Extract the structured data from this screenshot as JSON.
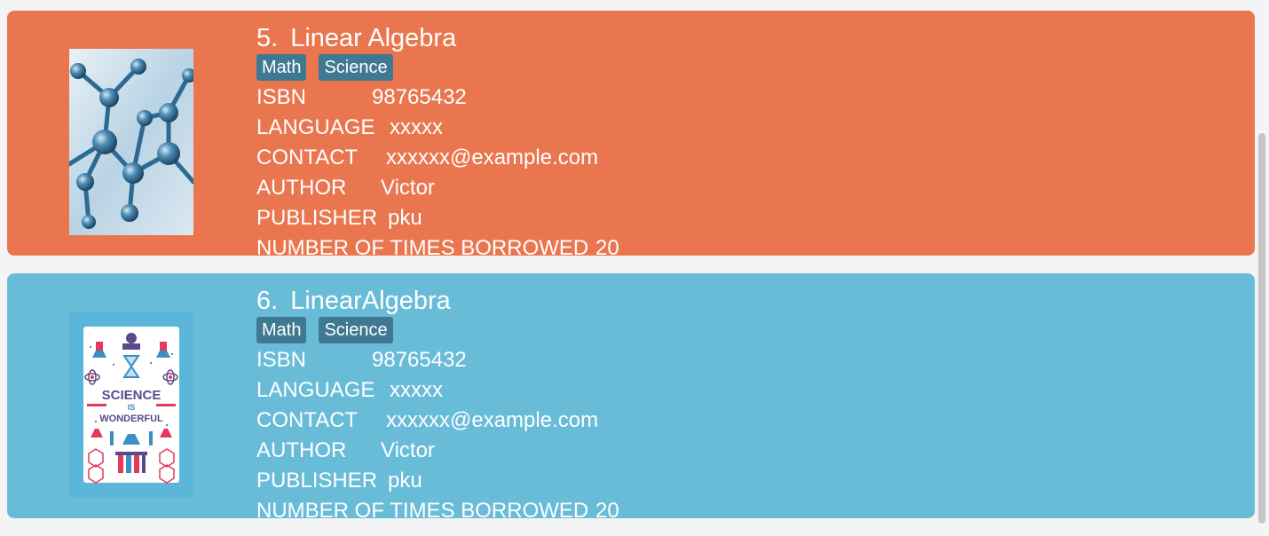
{
  "books": [
    {
      "index": "5.",
      "title": "Linear Algebra",
      "tags": [
        "Math",
        "Science"
      ],
      "labels": {
        "isbn": "ISBN",
        "language": "LANGUAGE",
        "contact": "CONTACT",
        "author": "AUTHOR",
        "publisher": "PUBLISHER",
        "borrowed": "NUMBER OF TIMES BORROWED"
      },
      "isbn": "98765432",
      "language": "xxxxx",
      "contact": "xxxxxx@example.com",
      "author": "Victor",
      "publisher": "pku",
      "borrowed": "20",
      "cover_icon": "molecule-structure-image",
      "color": "#e9764f"
    },
    {
      "index": "6.",
      "title": "LinearAlgebra",
      "tags": [
        "Math",
        "Science"
      ],
      "labels": {
        "isbn": "ISBN",
        "language": "LANGUAGE",
        "contact": "CONTACT",
        "author": "AUTHOR",
        "publisher": "PUBLISHER",
        "borrowed": "NUMBER OF TIMES BORROWED"
      },
      "isbn": "98765432",
      "language": "xxxxx",
      "contact": "xxxxxx@example.com",
      "author": "Victor",
      "publisher": "pku",
      "borrowed": "20",
      "cover_icon": "science-poster-image",
      "cover_text": [
        "SCIENCE",
        "IS",
        "WONDERFUL"
      ],
      "color": "#69bcd8"
    }
  ],
  "colors": {
    "tag_bg": "#3f7891",
    "text": "#ffffff"
  }
}
